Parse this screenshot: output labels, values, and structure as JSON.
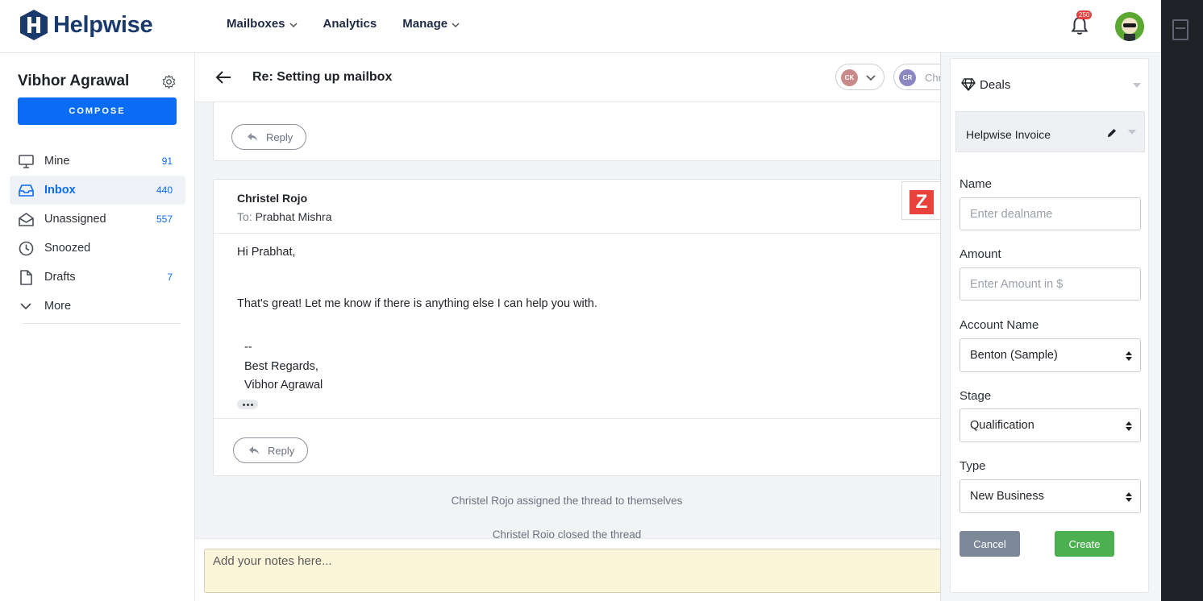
{
  "app": {
    "brand": "Helpwise",
    "brand_color": "#1a3a6b",
    "accent": "#0a6cf5"
  },
  "nav": {
    "items": [
      {
        "label": "Mailboxes",
        "has_dropdown": true
      },
      {
        "label": "Analytics",
        "has_dropdown": false
      },
      {
        "label": "Manage",
        "has_dropdown": true
      }
    ],
    "notification_count": "250"
  },
  "sidebar": {
    "user_name": "Vibhor Agrawal",
    "compose_label": "COMPOSE",
    "items": [
      {
        "label": "Mine",
        "count": "91",
        "icon": "monitor-icon"
      },
      {
        "label": "Inbox",
        "count": "440",
        "icon": "inbox-icon",
        "active": true
      },
      {
        "label": "Unassigned",
        "count": "557",
        "icon": "open-envelope-icon"
      },
      {
        "label": "Snoozed",
        "count": "",
        "icon": "clock-icon"
      },
      {
        "label": "Drafts",
        "count": "7",
        "icon": "file-icon"
      },
      {
        "label": "More",
        "count": "",
        "icon": "chevron-down-icon"
      }
    ]
  },
  "thread": {
    "subject": "Re: Setting up mailbox",
    "assignee_initials": "CK",
    "assignee_color": "#c98a8a",
    "status_initials": "CR",
    "status_avatar_color": "#8a87c2",
    "status_text": "Chr",
    "reply_label": "Reply",
    "message": {
      "sender": "Christel Rojo",
      "to_label": "To:",
      "to": "Prabhat Mishra",
      "greeting": "Hi Prabhat,",
      "body": "That's great! Let me know if there is anything else I can help you with.",
      "sig_dash": "--",
      "sig_regards": "Best Regards,",
      "sig_name": "Vibhor Agrawal"
    },
    "zoho_letter": "Z",
    "activity": [
      "Christel Rojo assigned the thread to themselves",
      "Christel Rojo closed the thread"
    ],
    "notes_placeholder": "Add your notes here..."
  },
  "deals": {
    "title": "Deals",
    "pipeline": "Helpwise Invoice",
    "fields": {
      "name_label": "Name",
      "name_placeholder": "Enter dealname",
      "amount_label": "Amount",
      "amount_placeholder": "Enter Amount in $",
      "account_label": "Account Name",
      "account_value": "Benton (Sample)",
      "stage_label": "Stage",
      "stage_value": "Qualification",
      "type_label": "Type",
      "type_value": "New Business"
    },
    "cancel_label": "Cancel",
    "create_label": "Create"
  }
}
